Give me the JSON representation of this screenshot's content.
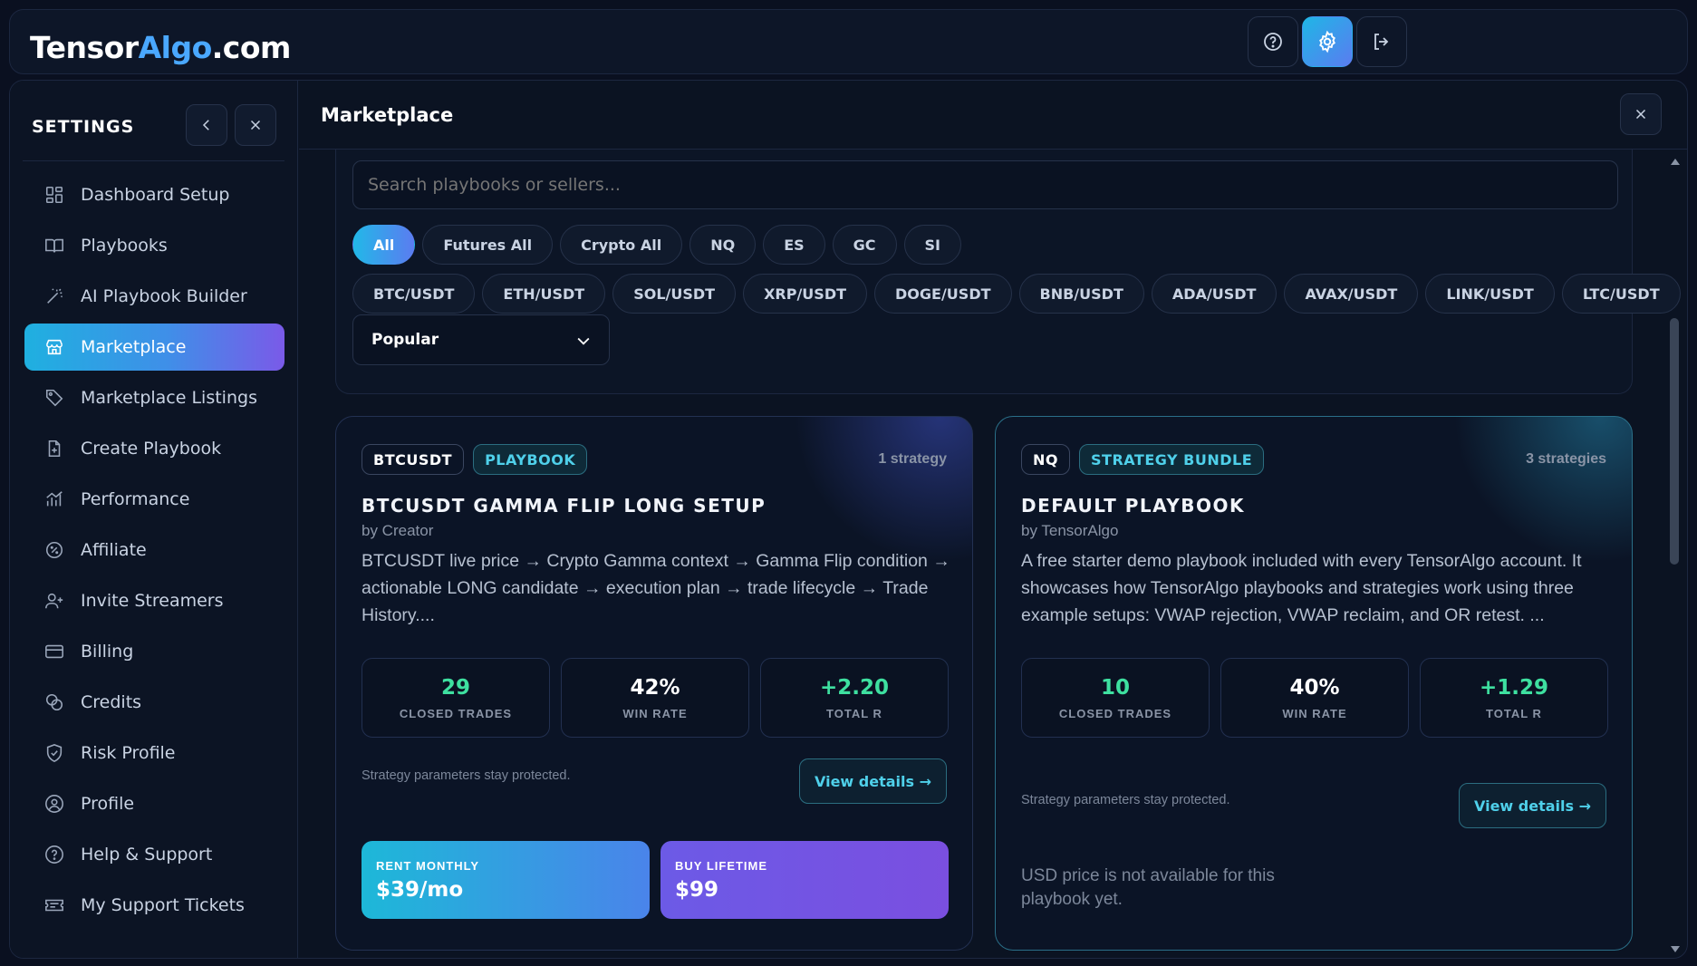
{
  "brand": {
    "part1": "Tensor",
    "part2": "Algo",
    "part3": ".com"
  },
  "topbar": {
    "help_icon": "question-circle-icon",
    "settings_icon": "gear-icon",
    "logout_icon": "logout-icon"
  },
  "settings": {
    "title": "SETTINGS",
    "nav": [
      {
        "label": "Dashboard Setup",
        "icon": "grid-icon"
      },
      {
        "label": "Playbooks",
        "icon": "book-icon"
      },
      {
        "label": "AI Playbook Builder",
        "icon": "wand-icon"
      },
      {
        "label": "Marketplace",
        "icon": "store-icon",
        "active": true
      },
      {
        "label": "Marketplace Listings",
        "icon": "tag-icon"
      },
      {
        "label": "Create Playbook",
        "icon": "file-plus-icon"
      },
      {
        "label": "Performance",
        "icon": "chart-icon"
      },
      {
        "label": "Affiliate",
        "icon": "percent-badge-icon"
      },
      {
        "label": "Invite Streamers",
        "icon": "user-plus-icon"
      },
      {
        "label": "Billing",
        "icon": "card-icon"
      },
      {
        "label": "Credits",
        "icon": "coins-icon"
      },
      {
        "label": "Risk Profile",
        "icon": "shield-icon"
      },
      {
        "label": "Profile",
        "icon": "user-circle-icon"
      },
      {
        "label": "Help & Support",
        "icon": "help-icon"
      },
      {
        "label": "My Support Tickets",
        "icon": "ticket-icon"
      }
    ]
  },
  "main": {
    "title": "Marketplace",
    "search_placeholder": "Search playbooks or sellers...",
    "chips_row1": [
      "All",
      "Futures All",
      "Crypto All",
      "NQ",
      "ES",
      "GC",
      "SI"
    ],
    "chips_row2": [
      "BTC/USDT",
      "ETH/USDT",
      "SOL/USDT",
      "XRP/USDT",
      "DOGE/USDT",
      "BNB/USDT",
      "ADA/USDT",
      "AVAX/USDT",
      "LINK/USDT",
      "LTC/USDT"
    ],
    "active_chip": "All",
    "sort": "Popular"
  },
  "cards": [
    {
      "symbol": "BTCUSDT",
      "kind": "PLAYBOOK",
      "count": "1 strategy",
      "title": "BTCUSDT GAMMA FLIP LONG SETUP",
      "by": "by Creator",
      "desc": "BTCUSDT live price → Crypto Gamma context → Gamma Flip condition → actionable LONG candidate → execution plan → trade lifecycle → Trade History....",
      "stats": [
        {
          "value": "29",
          "label": "CLOSED TRADES"
        },
        {
          "value": "42%",
          "label": "WIN RATE"
        },
        {
          "value": "+2.20",
          "label": "TOTAL R"
        }
      ],
      "protected": "Strategy parameters stay protected.",
      "details": "View details →",
      "rent_label": "RENT MONTHLY",
      "rent_value": "$39/mo",
      "buy_label": "BUY LIFETIME",
      "buy_value": "$99"
    },
    {
      "symbol": "NQ",
      "kind": "STRATEGY BUNDLE",
      "count": "3 strategies",
      "title": "DEFAULT PLAYBOOK",
      "by": "by TensorAlgo",
      "desc": "A free starter demo playbook included with every TensorAlgo account. It showcases how TensorAlgo playbooks and strategies work using three example setups: VWAP rejection, VWAP reclaim, and OR retest. ...",
      "stats": [
        {
          "value": "10",
          "label": "CLOSED TRADES"
        },
        {
          "value": "40%",
          "label": "WIN RATE"
        },
        {
          "value": "+1.29",
          "label": "TOTAL R"
        }
      ],
      "protected": "Strategy parameters stay protected.",
      "details": "View details →",
      "no_usd": "USD price is not available for this playbook yet."
    }
  ]
}
